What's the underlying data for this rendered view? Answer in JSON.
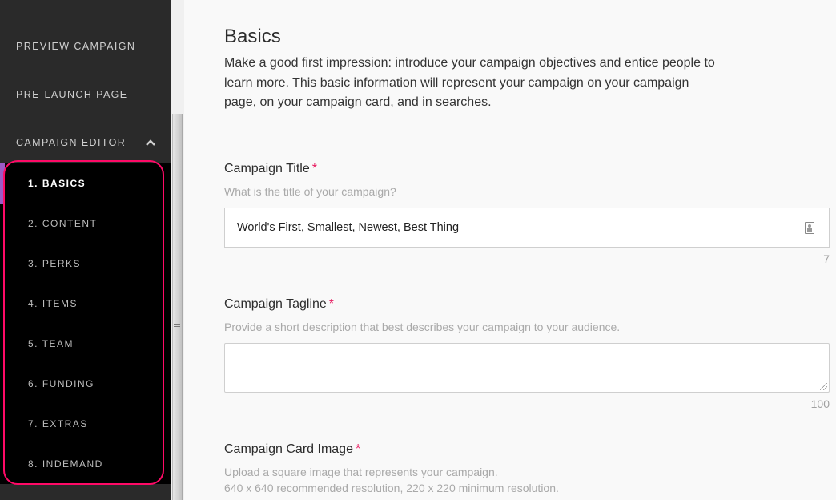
{
  "sidebar": {
    "preview_label": "PREVIEW CAMPAIGN",
    "prelaunch_label": "PRE-LAUNCH PAGE",
    "editor_label": "CAMPAIGN EDITOR",
    "editor_expanded_icon": "chevron-up-icon",
    "active_accent_color": "#9b5bc6",
    "highlight_color": "#ff0a67",
    "items": [
      {
        "label": "1. BASICS",
        "active": true
      },
      {
        "label": "2. CONTENT",
        "active": false
      },
      {
        "label": "3. PERKS",
        "active": false
      },
      {
        "label": "4. ITEMS",
        "active": false
      },
      {
        "label": "5. TEAM",
        "active": false
      },
      {
        "label": "6. FUNDING",
        "active": false
      },
      {
        "label": "7. EXTRAS",
        "active": false
      },
      {
        "label": "8. INDEMAND",
        "active": false
      }
    ]
  },
  "main": {
    "title": "Basics",
    "intro": "Make a good first impression: introduce your campaign objectives and entice people to learn more. This basic information will represent your campaign on your campaign page, on your campaign card, and in searches.",
    "required_marker": "*",
    "campaign_title": {
      "label": "Campaign Title",
      "help": "What is the title of your campaign?",
      "value": "World's First, Smallest, Newest, Best Thing",
      "icon": "contact-card-icon",
      "remaining": "7"
    },
    "campaign_tagline": {
      "label": "Campaign Tagline",
      "help": "Provide a short description that best describes your campaign to your audience.",
      "value": "",
      "remaining": "100"
    },
    "campaign_card_image": {
      "label": "Campaign Card Image",
      "help_line1": "Upload a square image that represents your campaign.",
      "help_line2": "640 x 640 recommended resolution, 220 x 220 minimum resolution."
    }
  }
}
